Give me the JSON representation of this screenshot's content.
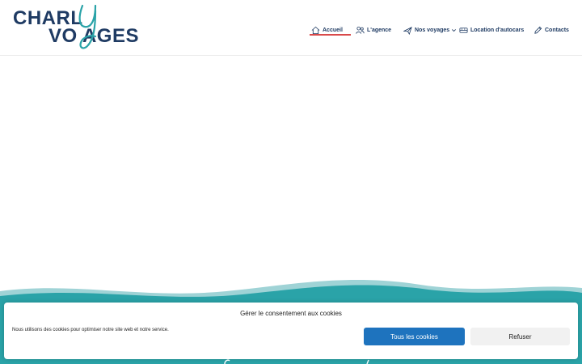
{
  "brand": {
    "logo_line1": "CHARL",
    "logo_line2": "VO  AGES",
    "colors": {
      "navy": "#1f3b63",
      "teal": "#2aa3a8",
      "accent_red": "#d94a4a"
    }
  },
  "nav": {
    "items": [
      {
        "label": "Accueil",
        "icon": "home-icon",
        "active": true
      },
      {
        "label": "L'agence",
        "icon": "users-icon"
      },
      {
        "label": "Nos voyages",
        "icon": "plane-icon",
        "has_dropdown": true
      },
      {
        "label": "Location d'autocars",
        "icon": "bus-icon"
      },
      {
        "label": "Contacts",
        "icon": "pencil-icon"
      }
    ]
  },
  "cookie_banner": {
    "title": "Gérer le consentement aux cookies",
    "text": "Nous utilisons des cookies pour optimiser notre site web et notre service.",
    "accept_label": "Tous les cookies",
    "refuse_label": "Refuser",
    "accept_color": "#1e73be"
  }
}
